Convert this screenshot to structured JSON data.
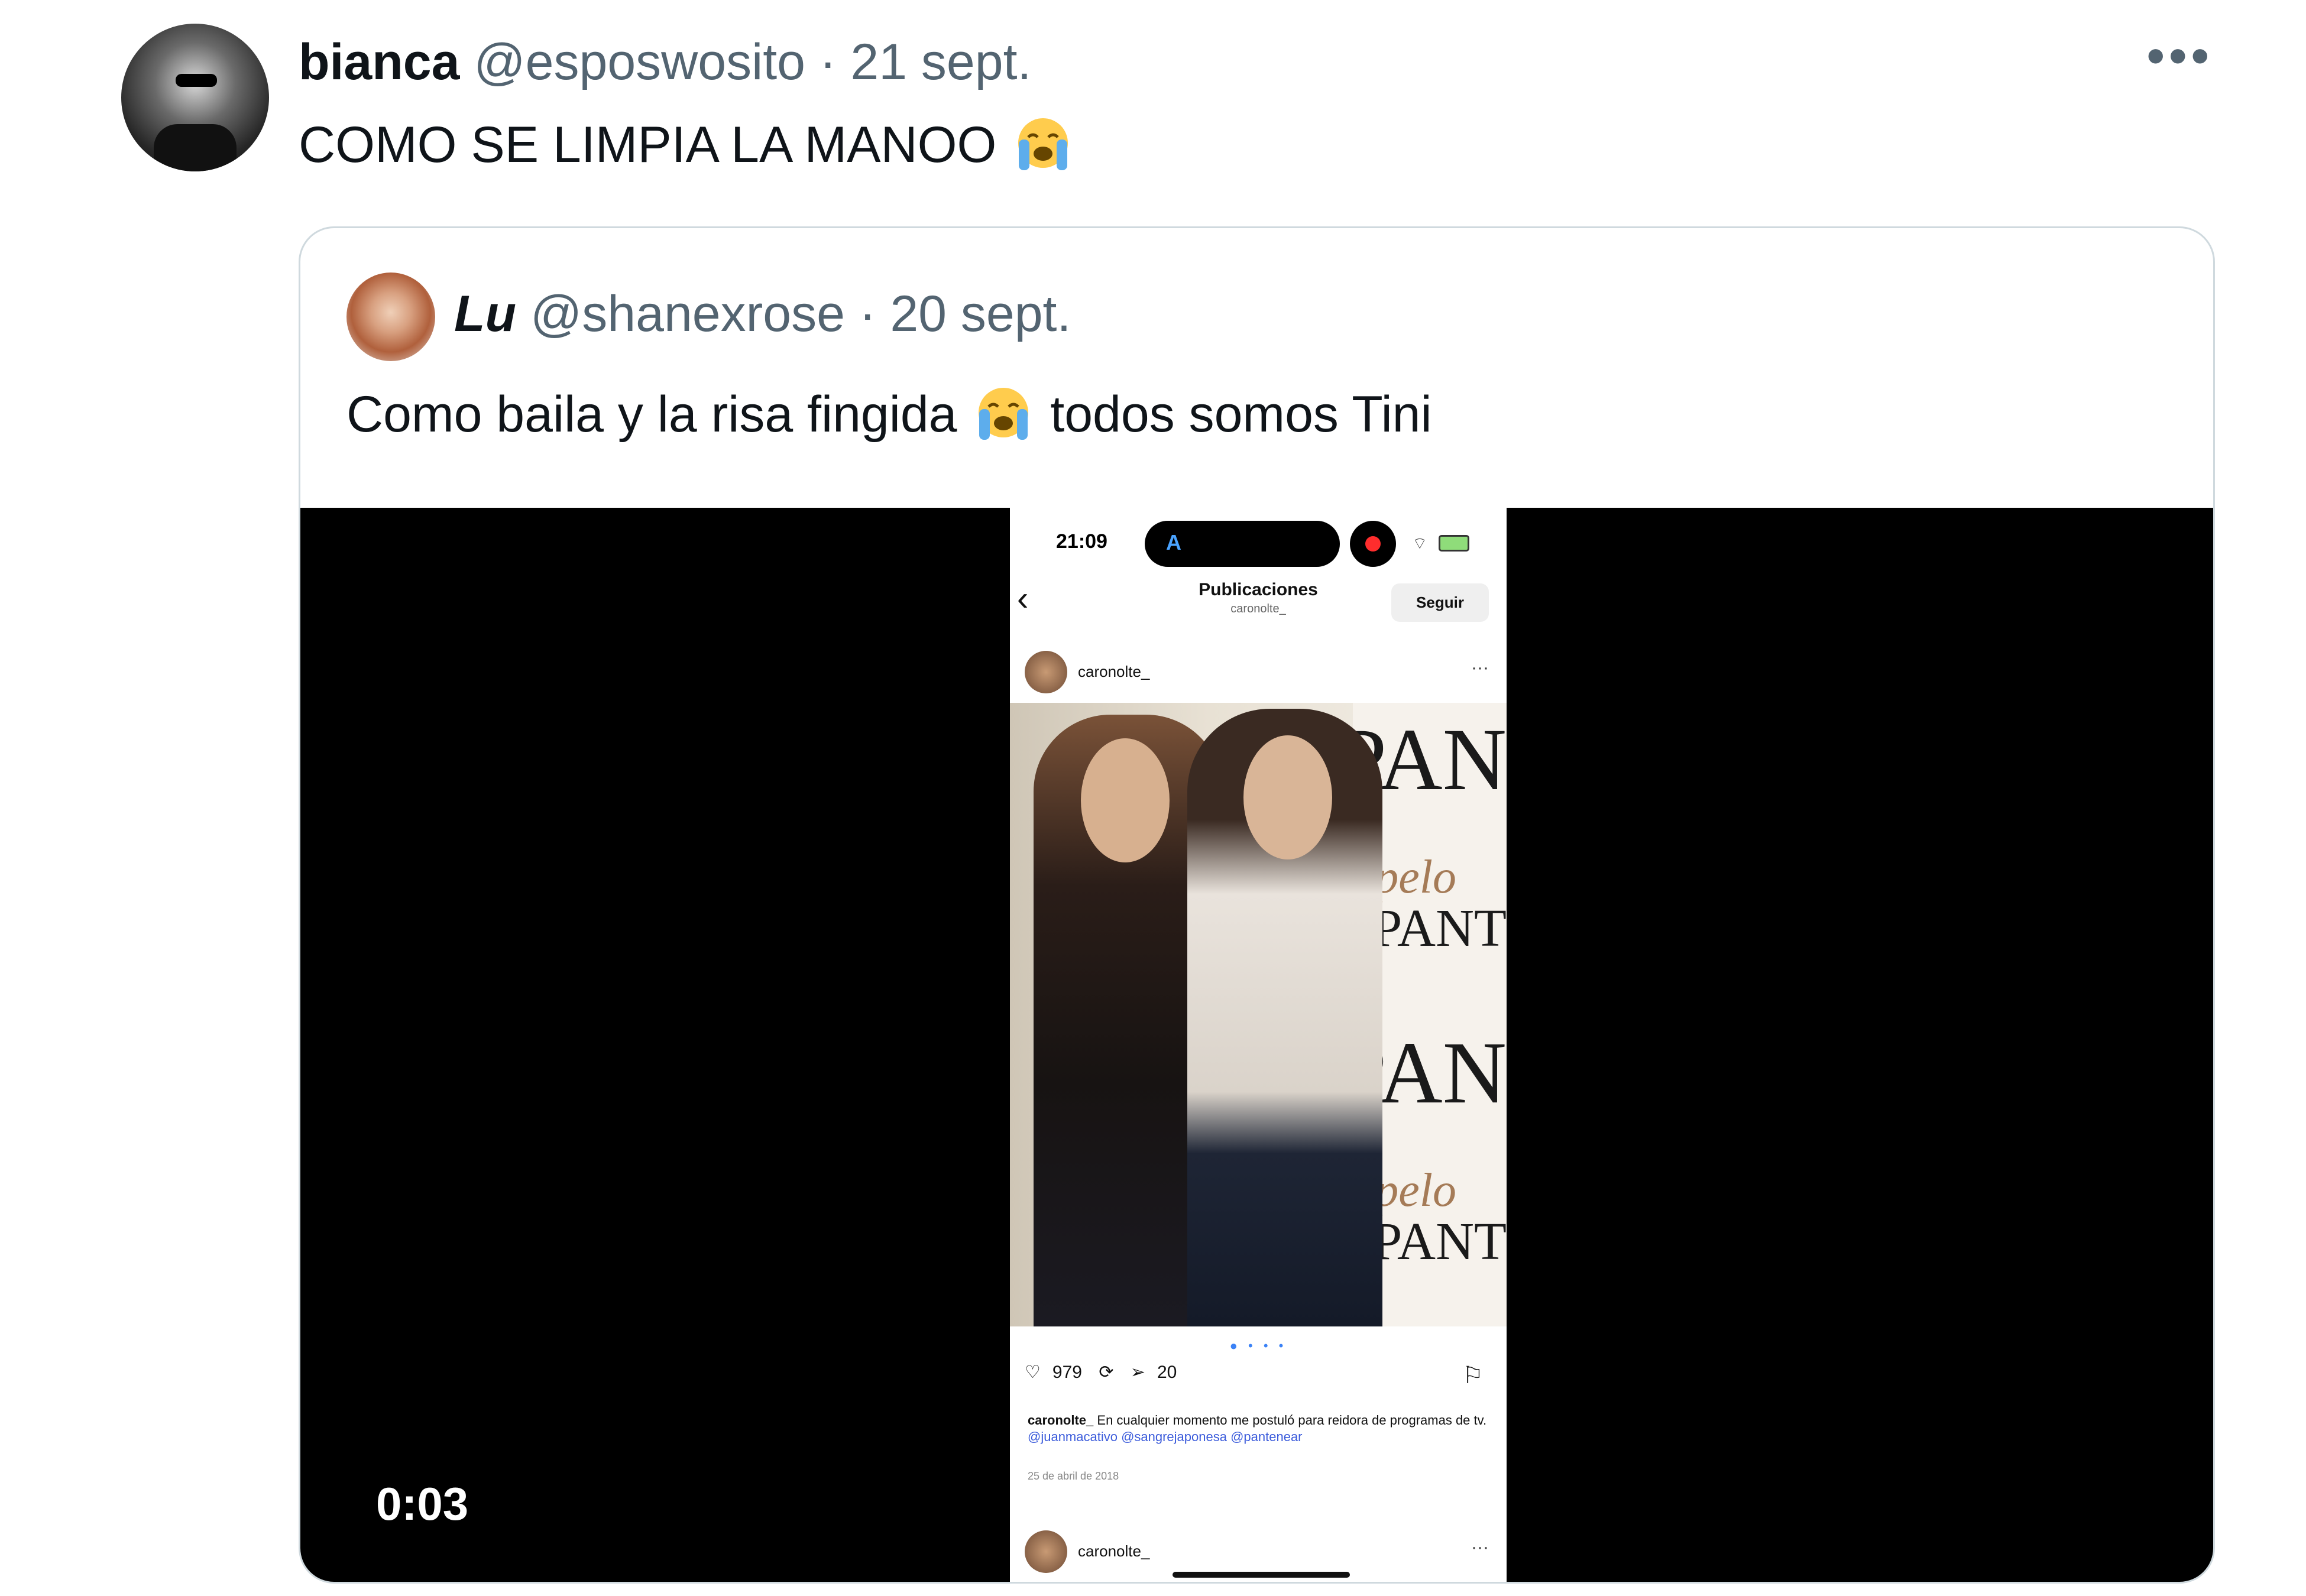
{
  "tweet": {
    "display_name": "bianca",
    "handle": "@esposwosito",
    "date": "· 21 sept.",
    "text": "COMO SE LIMPIA LA MANOO",
    "emoji": "crying-face-emoji"
  },
  "more_menu": "•••",
  "quoted": {
    "display_name": "Lu",
    "handle": "@shanexrose",
    "date": "· 20 sept.",
    "text_before": "Como baila y la risa fingida",
    "text_after": "todos somos Tini",
    "emoji": "crying-face-emoji"
  },
  "video": {
    "timecode": "0:03",
    "phone": {
      "time": "21:09",
      "island_glyph": "A",
      "title": "Publicaciones",
      "subtitle": "caronolte_",
      "follow_label": "Seguir",
      "username": "caronolte_",
      "dots": "···",
      "brand_text": "PAN",
      "brand_text_long": "PANT",
      "pelo_text": "pelo",
      "carousel_dots": "● • • •",
      "likes": "979",
      "shares": "20",
      "caption_user": "caronolte_",
      "caption_text": "En cualquier momento me postuló para reidora de programas de tv.",
      "caption_tags": "@juanmacativo @sangrejaponesa @pantenear",
      "date": "25 de abril de 2018",
      "username_2": "caronolte_"
    }
  },
  "colors": {
    "text": "#0f1419",
    "muted": "#536471",
    "border": "#cfd9de",
    "video_bg": "#000000"
  }
}
